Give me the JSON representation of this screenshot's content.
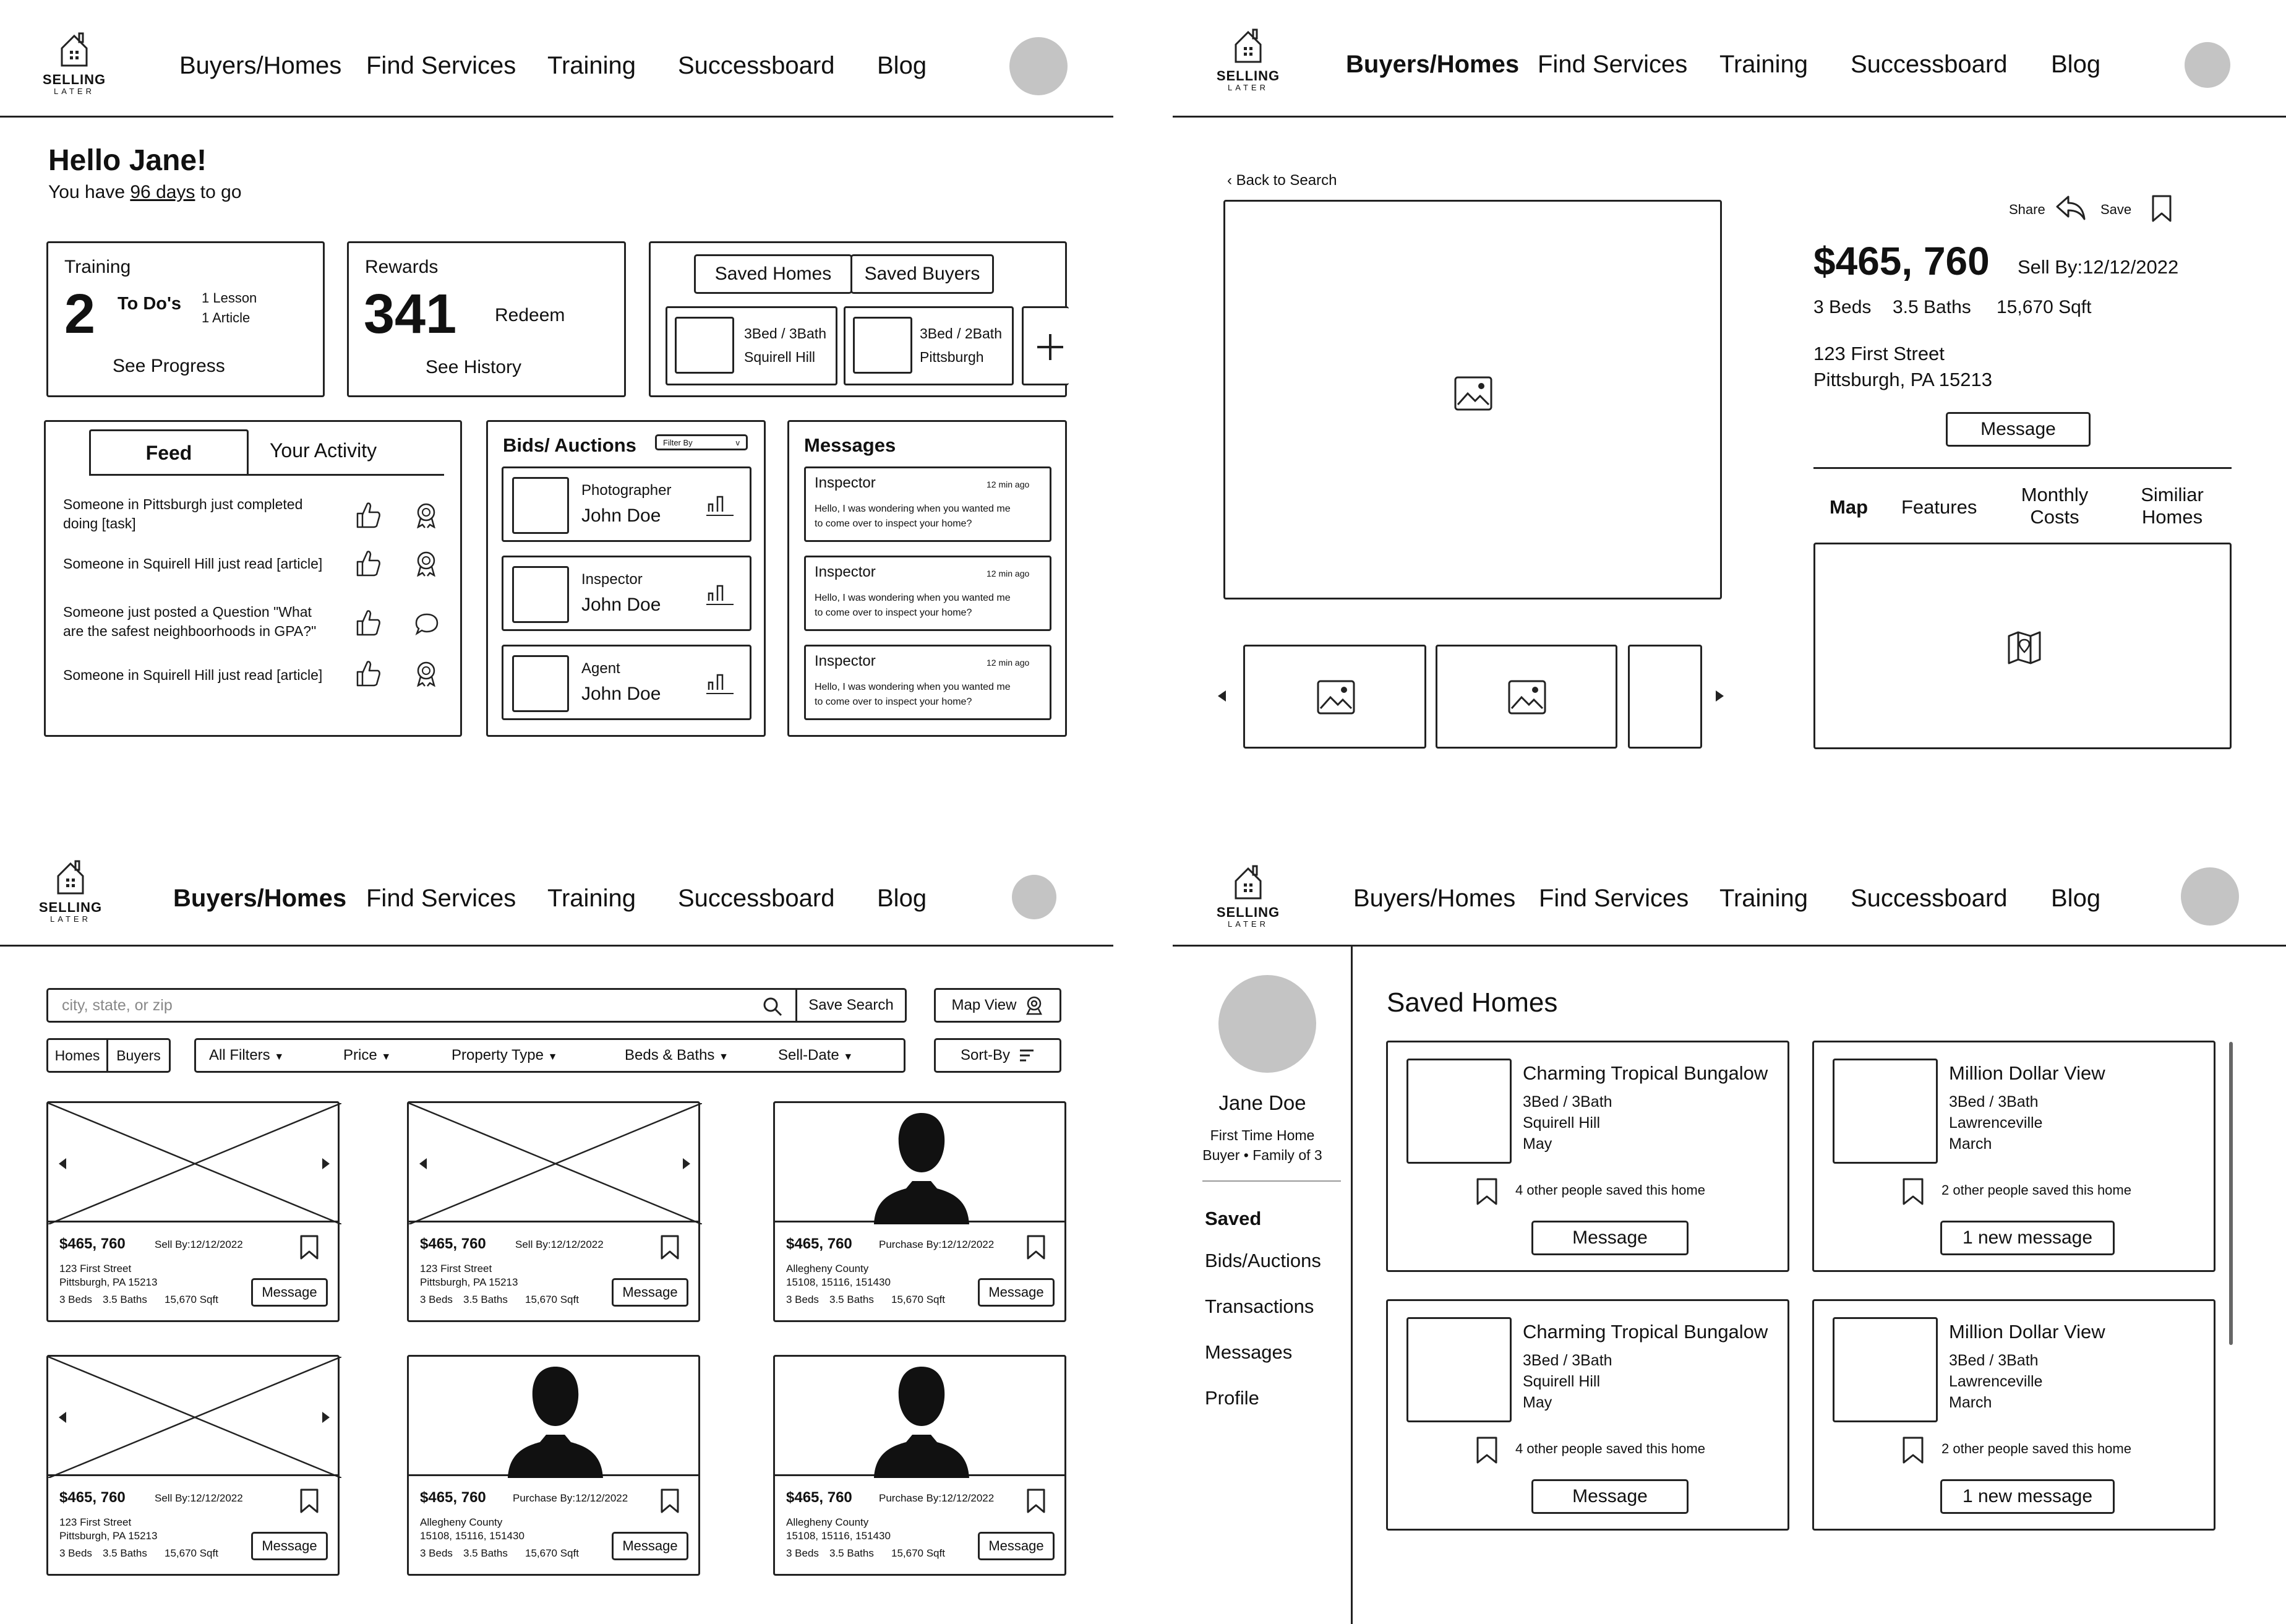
{
  "logo": {
    "line1": "SELLING",
    "line2": "LATER"
  },
  "nav": [
    "Buyers/Homes",
    "Find Services",
    "Training",
    "Successboard",
    "Blog"
  ],
  "dashboard": {
    "greeting": "Hello Jane!",
    "countdown_pre": "You have",
    "countdown_days": "96 days",
    "countdown_post": "to go",
    "training": {
      "title": "Training",
      "count": "2",
      "todo": "To Do's",
      "lesson": "1 Lesson",
      "article": "1 Article",
      "link": "See Progress"
    },
    "rewards": {
      "title": "Rewards",
      "points": "341",
      "redeem": "Redeem",
      "link": "See History"
    },
    "saved": {
      "tab_homes": "Saved Homes",
      "tab_buyers": "Saved Buyers",
      "cards": [
        {
          "beds": "3Bed / 3Bath",
          "loc": "Squirell Hill"
        },
        {
          "beds": "3Bed / 2Bath",
          "loc": "Pittsburgh"
        }
      ]
    },
    "feed": {
      "tab_feed": "Feed",
      "tab_activity": "Your Activity",
      "items": [
        {
          "l1": "Someone in Pittsburgh just completed",
          "l2": "doing [task]"
        },
        {
          "l1": "Someone in Squirell Hill just read [article]",
          "l2": ""
        },
        {
          "l1": "Someone just posted a Question \"What",
          "l2": "are the safest neighboorhoods in GPA?\""
        },
        {
          "l1": "Someone in Squirell Hill just read [article]",
          "l2": ""
        }
      ]
    },
    "bids": {
      "title": "Bids/ Auctions",
      "filter": "Filter By",
      "filter_arrow": "v",
      "items": [
        {
          "role": "Photographer",
          "name": "John Doe"
        },
        {
          "role": "Inspector",
          "name": "John Doe"
        },
        {
          "role": "Agent",
          "name": "John Doe"
        }
      ]
    },
    "messages": {
      "title": "Messages",
      "items": [
        {
          "from": "Inspector",
          "time": "12 min ago",
          "l1": "Hello, I was wondering when you wanted me",
          "l2": "to come over to inspect your home?"
        },
        {
          "from": "Inspector",
          "time": "12 min ago",
          "l1": "Hello, I was wondering when you wanted me",
          "l2": "to come over to inspect your home?"
        },
        {
          "from": "Inspector",
          "time": "12 min ago",
          "l1": "Hello, I was wondering when you wanted me",
          "l2": "to come over to inspect your home?"
        }
      ]
    }
  },
  "detail": {
    "back": "‹ Back to Search",
    "share": "Share",
    "save": "Save",
    "price": "$465, 760",
    "sellby": "Sell By:12/12/2022",
    "beds": "3 Beds",
    "baths": "3.5 Baths",
    "sqft": "15,670 Sqft",
    "addr1": "123  First Street",
    "addr2": "Pittsburgh, PA 15213",
    "message": "Message",
    "tabs": [
      "Map",
      "Features",
      "Monthly",
      "Costs",
      "Similiar",
      "Homes"
    ]
  },
  "search": {
    "placeholder": "city, state, or zip",
    "save_search": "Save Search",
    "map_view": "Map View",
    "toggle_homes": "Homes",
    "toggle_buyers": "Buyers",
    "filters": [
      "All Filters",
      "Price",
      "Property Type",
      "Beds & Baths",
      "Sell-Date"
    ],
    "sort": "Sort-By",
    "cards": [
      {
        "price": "$465, 760",
        "tag": "Sell By:12/12/2022",
        "a1": "123 First Street",
        "a2": "Pittsburgh, PA 15213",
        "beds": "3 Beds",
        "baths": "3.5 Baths",
        "sqft": "15,670 Sqft",
        "btn": "Message",
        "kind": "home"
      },
      {
        "price": "$465, 760",
        "tag": "Sell By:12/12/2022",
        "a1": "123 First Street",
        "a2": "Pittsburgh, PA 15213",
        "beds": "3 Beds",
        "baths": "3.5 Baths",
        "sqft": "15,670 Sqft",
        "btn": "Message",
        "kind": "home"
      },
      {
        "price": "$465, 760",
        "tag": "Purchase  By:12/12/2022",
        "a1": "Allegheny County",
        "a2": "15108, 15116, 151430",
        "beds": "3 Beds",
        "baths": "3.5 Baths",
        "sqft": "15,670 Sqft",
        "btn": "Message",
        "kind": "buyer"
      },
      {
        "price": "$465, 760",
        "tag": "Sell By:12/12/2022",
        "a1": "123 First Street",
        "a2": "Pittsburgh, PA 15213",
        "beds": "3 Beds",
        "baths": "3.5 Baths",
        "sqft": "15,670 Sqft",
        "btn": "Message",
        "kind": "home"
      },
      {
        "price": "$465, 760",
        "tag": "Purchase  By:12/12/2022",
        "a1": "Allegheny County",
        "a2": "15108, 15116, 151430",
        "beds": "3 Beds",
        "baths": "3.5 Baths",
        "sqft": "15,670 Sqft",
        "btn": "Message",
        "kind": "buyer"
      },
      {
        "price": "$465, 760",
        "tag": "Purchase  By:12/12/2022",
        "a1": "Allegheny County",
        "a2": "15108, 15116, 151430",
        "beds": "3 Beds",
        "baths": "3.5 Baths",
        "sqft": "15,670 Sqft",
        "btn": "Message",
        "kind": "buyer"
      }
    ]
  },
  "profile": {
    "name": "Jane Doe",
    "sub1": "First Time Home",
    "sub2": "Buyer • Family of 3",
    "menu": [
      "Saved",
      "Bids/Auctions",
      "Transactions",
      "Messages",
      "Profile"
    ],
    "heading": "Saved Homes",
    "cards": [
      {
        "title": "Charming Tropical Bungalow",
        "beds": "3Bed / 3Bath",
        "loc": "Squirell Hill",
        "month": "May",
        "saved": "4 other people saved this home",
        "btn": "Message"
      },
      {
        "title": "Million Dollar View",
        "beds": "3Bed / 3Bath",
        "loc": "Lawrenceville",
        "month": "March",
        "saved": "2 other people saved this home",
        "btn": "1 new message"
      },
      {
        "title": "Charming Tropical Bungalow",
        "beds": "3Bed / 3Bath",
        "loc": "Squirell Hill",
        "month": "May",
        "saved": "4 other people saved this home",
        "btn": "Message"
      },
      {
        "title": "Million Dollar View",
        "beds": "3Bed / 3Bath",
        "loc": "Lawrenceville",
        "month": "March",
        "saved": "2 other people saved this home",
        "btn": "1 new message"
      }
    ]
  }
}
